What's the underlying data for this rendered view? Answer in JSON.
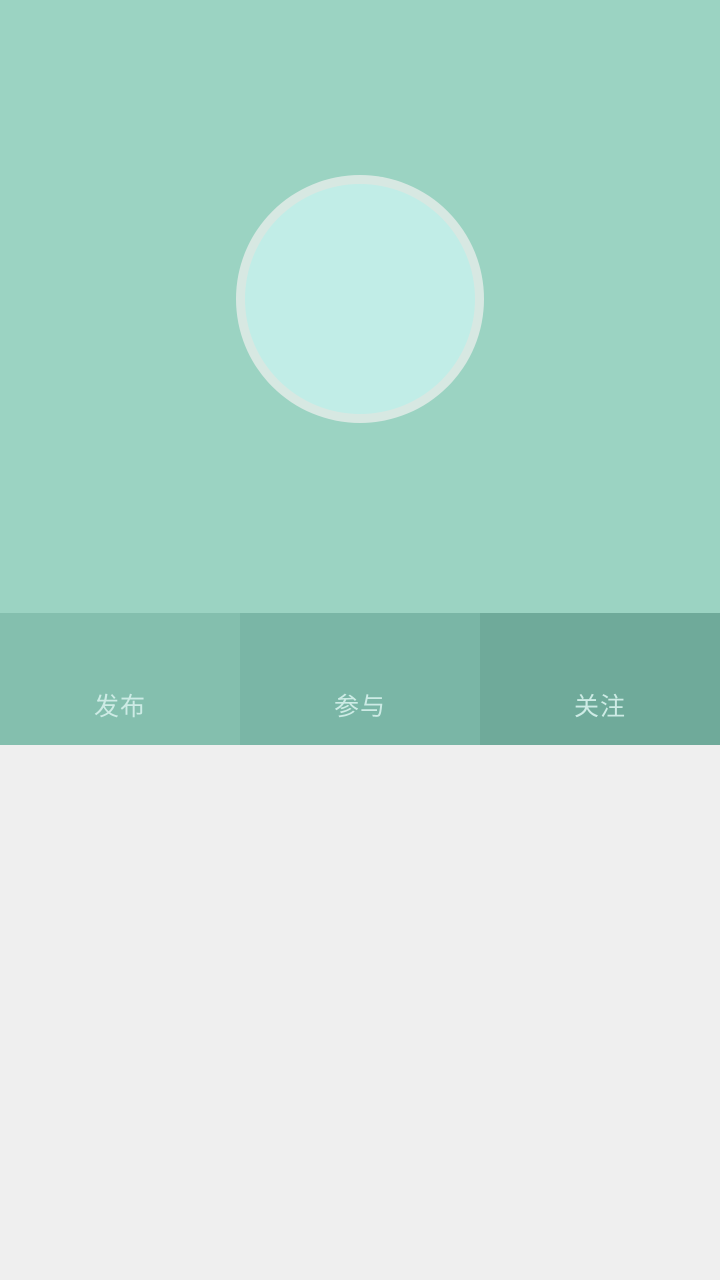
{
  "colors": {
    "header_bg": "#9bd3c2",
    "avatar_ring": "#d7e8e2",
    "avatar_fill": "#c1ede7",
    "tab_1_bg": "#84bfae",
    "tab_2_bg": "#7ab6a6",
    "tab_3_bg": "#6faa9a",
    "tab_text": "#cdebe5",
    "content_bg": "#efefef"
  },
  "tabs": [
    {
      "label": "发布"
    },
    {
      "label": "参与"
    },
    {
      "label": "关注"
    }
  ]
}
